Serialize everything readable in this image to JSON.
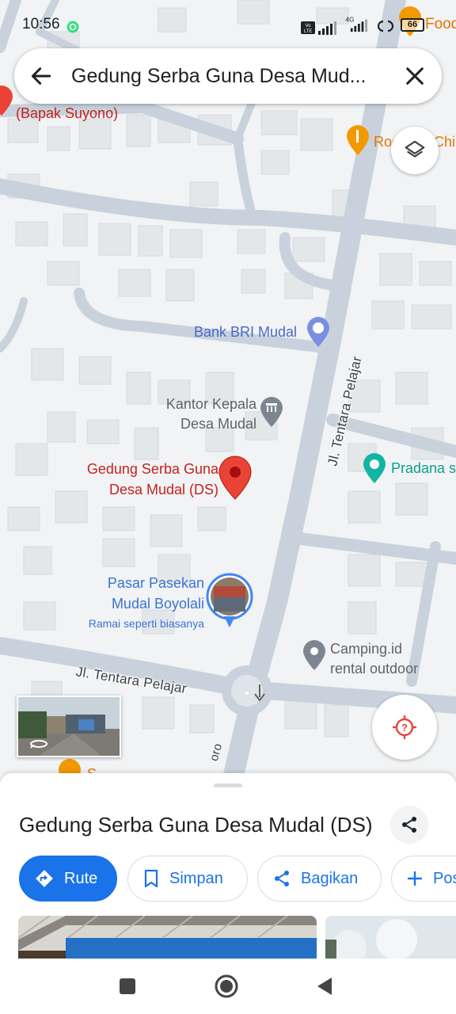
{
  "status_bar": {
    "time": "10:56",
    "icons": [
      "app-notification-icon",
      "volte-icon",
      "signal-icon",
      "4g-signal-icon",
      "link-icon",
      "battery-icon"
    ],
    "battery_level": "66"
  },
  "search": {
    "query": "Gedung Serba Guna Desa Mud...",
    "back_icon": "arrow-back-icon",
    "close_icon": "close-icon"
  },
  "map": {
    "labels": {
      "bapak_suyono": "(Bapak Suyono)",
      "bank_bri": "Bank BRI Mudal",
      "kantor_line1": "Kantor Kepala",
      "kantor_line2": "Desa Mudal",
      "gedung_line1": "Gedung Serba Guna",
      "gedung_line2": "Desa Mudal (DS)",
      "pradana": "Pradana s",
      "pasar_line1": "Pasar Pasekan",
      "pasar_line2": "Mudal Boyolali",
      "pasar_status": "Ramai seperti biasanya",
      "camping_line1": "Camping.id",
      "camping_line2": "rental outdoor",
      "food_top": "Food",
      "roc": "Roc",
      "chi": "Chi",
      "bottom_poi": "S"
    },
    "streets": {
      "tentara_pelajar_vertical": "Jl. Tentara Pelajar",
      "tentara_pelajar_horizontal": "Jl. Tentara Pelajar",
      "bottom_road": "oro"
    },
    "colors": {
      "road": "#c9d2dc",
      "building": "#e6e8eb",
      "background": "#f1f3f4",
      "pin": "#ea4335",
      "poi_blue": "#7b8fe0",
      "poi_grey": "#7d8590"
    }
  },
  "place": {
    "title": "Gedung Serba Guna Desa Mudal (DS)"
  },
  "actions": {
    "rute": "Rute",
    "simpan": "Simpan",
    "bagikan": "Bagikan",
    "post": "Pos"
  },
  "accent_color": "#1a73e8"
}
